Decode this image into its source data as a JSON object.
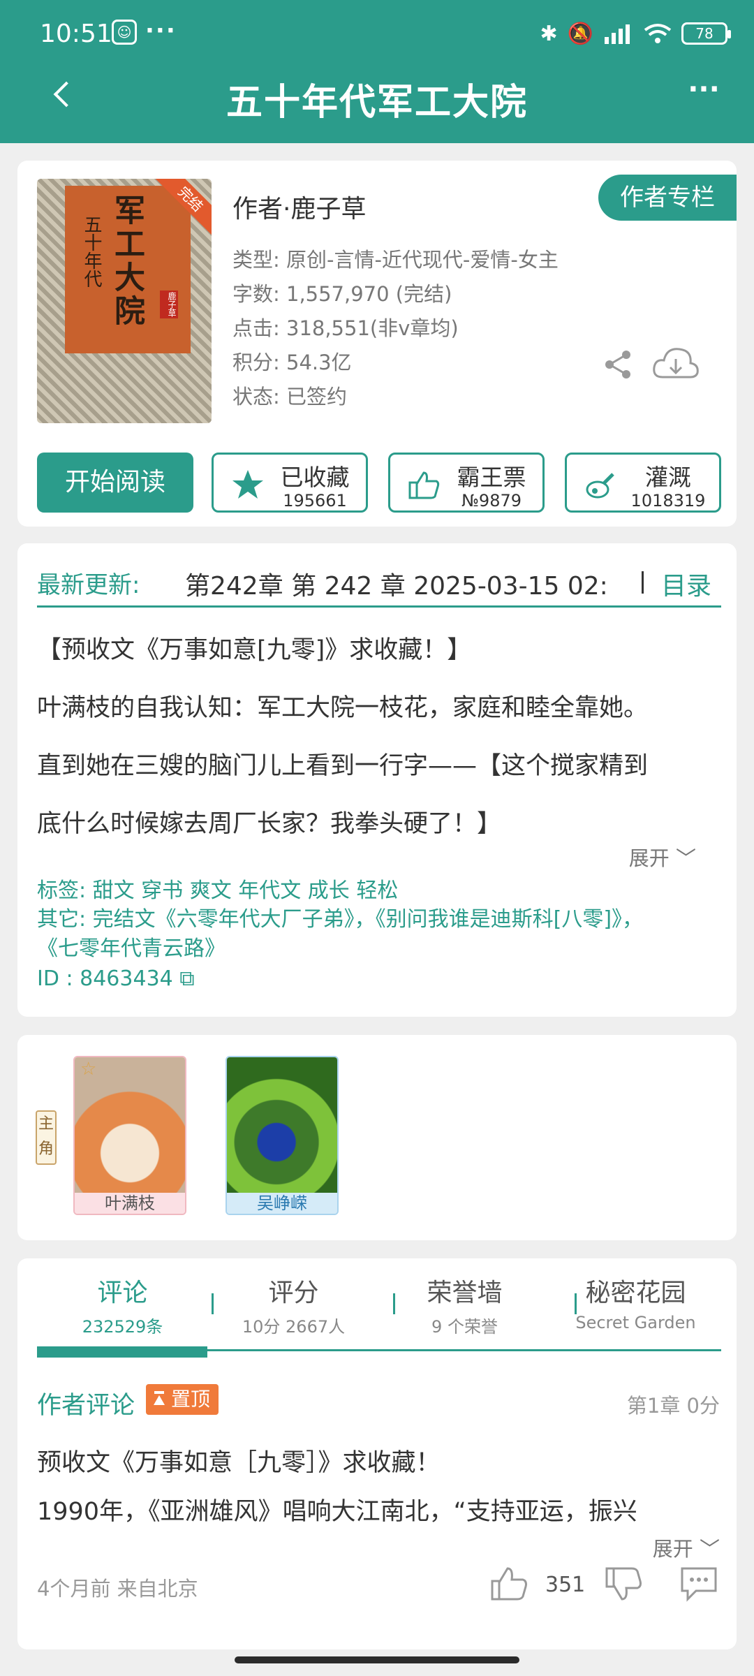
{
  "status_bar": {
    "time": "10:51",
    "dots": "···",
    "battery": "78"
  },
  "header": {
    "title": "五十年代军工大院"
  },
  "book": {
    "cover_title": "军工大院",
    "cover_subtitle": "五十年代",
    "cover_ribbon": "完结",
    "cover_author_seal": "鹿子草",
    "author_line": "作者·鹿子草",
    "author_column_label": "作者专栏",
    "meta": [
      "类型: 原创-言情-近代现代-爱情-女主",
      "字数: 1,557,970 (完结)",
      "点击: 318,551(非v章均)",
      "积分: 54.3亿",
      "状态: 已签约"
    ],
    "start_reading": "开始阅读",
    "actions": [
      {
        "label": "已收藏",
        "count": "195661",
        "icon": "star-icon"
      },
      {
        "label": "霸王票",
        "count": "№9879",
        "icon": "thumbs-up-icon"
      },
      {
        "label": "灌溉",
        "count": "1018319",
        "icon": "nutrient-bottle-icon"
      }
    ]
  },
  "update": {
    "label": "最新更新:",
    "text": "第242章  第 242 章  2025-03-15 02:",
    "toc": "目录"
  },
  "intro": {
    "lines": [
      "【预收文《万事如意[九零]》求收藏！】",
      "叶满枝的自我认知：军工大院一枝花，家庭和睦全靠她。",
      "直到她在三嫂的脑门儿上看到一行字——【这个搅家精到",
      "底什么时候嫁去周厂长家？我拳头硬了！】"
    ],
    "expand": "展开",
    "tags": "标签: 甜文 穿书 爽文 年代文 成长 轻松",
    "others": "其它: 完结文《六零年代大厂子弟》，《别问我谁是迪斯科[八零]》，《七零年代青云路》",
    "id": "ID   : 8463434"
  },
  "characters": {
    "role_tag": "主角",
    "list": [
      {
        "name": "叶满枝"
      },
      {
        "name": "吴峥嵘"
      }
    ]
  },
  "comments": {
    "tabs": [
      {
        "label": "评论",
        "sub": "232529条"
      },
      {
        "label": "评分",
        "sub": "10分 2667人"
      },
      {
        "label": "荣誉墙",
        "sub": "9 个荣誉"
      },
      {
        "label": "秘密花园",
        "sub": "Secret Garden"
      }
    ],
    "first": {
      "author": "作者评论",
      "pin": "置顶",
      "chapter": "第1章  0分",
      "lines": [
        "预收文《万事如意［九零］》求收藏！",
        "1990年，《亚洲雄风》唱响大江南北，“支持亚运，振兴"
      ],
      "expand": "展开",
      "meta": "4个月前  来自北京",
      "likes": "351"
    }
  },
  "colors": {
    "accent": "#2b9c8b",
    "pin": "#f07a3a"
  }
}
